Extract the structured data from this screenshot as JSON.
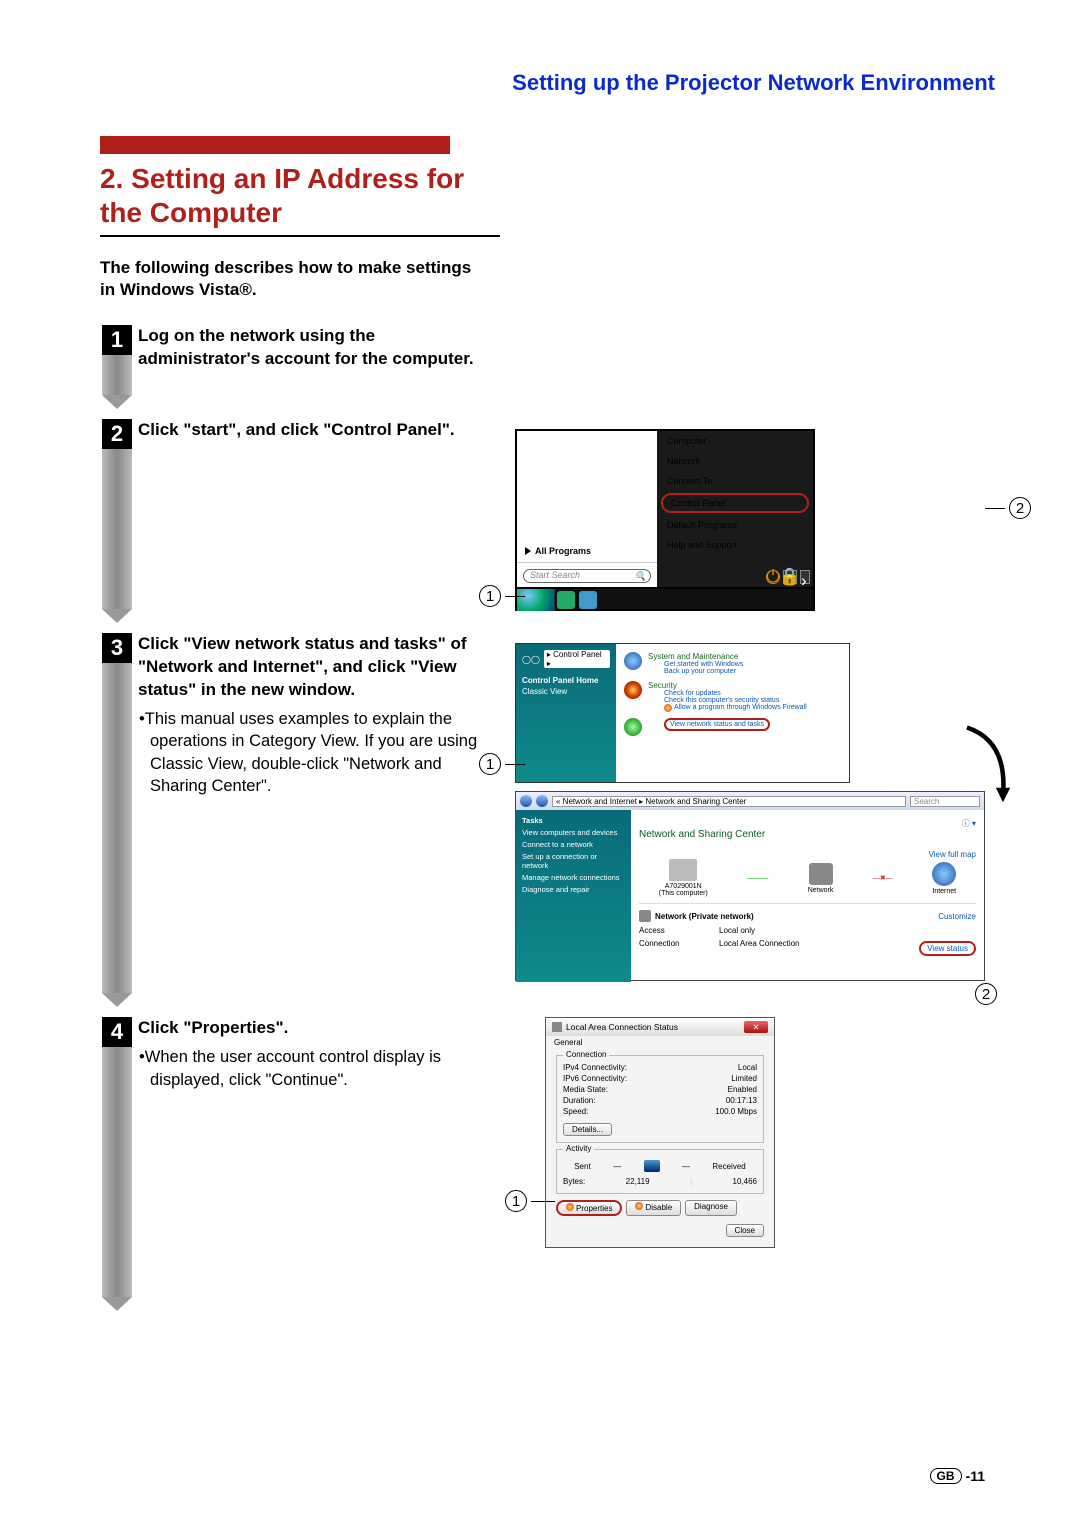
{
  "header": "Setting up the Projector Network Environment",
  "section": {
    "num": "2.",
    "title": "Setting an IP Address for the Computer"
  },
  "intro": "The following describes how to make settings in Windows Vista®.",
  "steps": [
    {
      "n": "1",
      "text": "Log on the network using the administrator's account for the computer."
    },
    {
      "n": "2",
      "text": "Click \"start\", and click \"Control Panel\"."
    },
    {
      "n": "3",
      "text": "Click \"View network status and tasks\" of \"Network and Internet\", and click \"View status\" in the new window.",
      "note": "•This manual uses examples to explain the operations in Category View. If you are using Classic View, double-click \"Network and Sharing Center\"."
    },
    {
      "n": "4",
      "text": "Click \"Properties\".",
      "note": "•When the user account control display is displayed, click \"Continue\"."
    }
  ],
  "startmenu": {
    "items": [
      "Computer",
      "Network",
      "Connect To",
      "Control Panel",
      "Default Programs",
      "Help and Support"
    ],
    "allprograms": "All Programs",
    "search": "Start Search"
  },
  "cpanel": {
    "sidebar_title": "Control Panel Home",
    "sidebar_sub": "Classic View",
    "addr": "▸ Control Panel ▸",
    "cat1": "System and Maintenance",
    "cat1_a": "Get started with Windows",
    "cat1_b": "Back up your computer",
    "cat2": "Security",
    "cat2_a": "Check for updates",
    "cat2_b": "Check this computer's security status",
    "cat2_c": "Allow a program through Windows Firewall",
    "cat3_hl": "View network status and tasks"
  },
  "nsc": {
    "addr": "« Network and Internet ▸ Network and Sharing Center",
    "search": "Search",
    "side_title": "Tasks",
    "side_items": [
      "View computers and devices",
      "Connect to a network",
      "Set up a connection or network",
      "Manage network connections",
      "Diagnose and repair"
    ],
    "title": "Network and Sharing Center",
    "viewmap": "View full map",
    "node_pc": "A7029001N\n(This computer)",
    "node_net": "Network",
    "node_int": "Internet",
    "net_label": "Network (Private network)",
    "customize": "Customize",
    "access_l": "Access",
    "access_r": "Local only",
    "conn_l": "Connection",
    "conn_r": "Local Area Connection",
    "viewstatus": "View status"
  },
  "lan": {
    "title": "Local Area Connection Status",
    "tab": "General",
    "group1": "Connection",
    "ipv4_l": "IPv4 Connectivity:",
    "ipv4_r": "Local",
    "ipv6_l": "IPv6 Connectivity:",
    "ipv6_r": "Limited",
    "media_l": "Media State:",
    "media_r": "Enabled",
    "dur_l": "Duration:",
    "dur_r": "00:17:13",
    "speed_l": "Speed:",
    "speed_r": "100.0 Mbps",
    "details": "Details...",
    "group2": "Activity",
    "sent": "Sent",
    "recv": "Received",
    "bytes_l": "Bytes:",
    "bytes_s": "22,119",
    "bytes_r": "10,466",
    "btn_prop": "Properties",
    "btn_dis": "Disable",
    "btn_diag": "Diagnose",
    "btn_close": "Close"
  },
  "footer": {
    "region": "GB",
    "page": "-11"
  }
}
